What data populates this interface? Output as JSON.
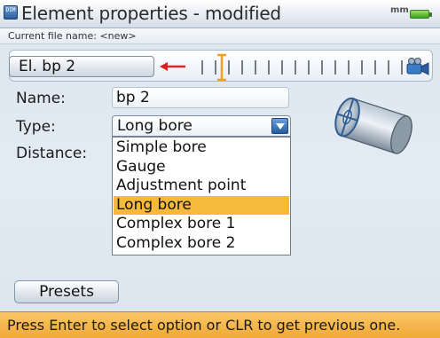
{
  "window": {
    "title": "Element properties - modified",
    "app_icon_text": "DIM",
    "units_badge": "mm",
    "battery_icon": "battery-full-icon",
    "filename_line": "Current file name: <new>"
  },
  "element_band": {
    "label": "El. bp 2",
    "arrow_icon": "left-arrow-icon",
    "camera_icon": "camera-icon",
    "accent_color": "#d82424",
    "marker_color": "#f2a020"
  },
  "form": {
    "name_label": "Name:",
    "name_value": "bp 2",
    "type_label": "Type:",
    "type_value": "Long bore",
    "distance_label": "Distance:",
    "dropdown_icon": "chevron-down-icon"
  },
  "type_options": [
    {
      "label": "Simple bore",
      "selected": false
    },
    {
      "label": "Gauge",
      "selected": false
    },
    {
      "label": "Adjustment point",
      "selected": false
    },
    {
      "label": "Long bore",
      "selected": true
    },
    {
      "label": "Complex bore 1",
      "selected": false
    },
    {
      "label": "Complex bore 2",
      "selected": false
    }
  ],
  "presets_label": "Presets",
  "status_text": "Press Enter to select option or CLR to get previous one.",
  "colors": {
    "highlight": "#f6b93a",
    "status_bar": "#f0a836",
    "dropdown_button": "#255c9e"
  }
}
